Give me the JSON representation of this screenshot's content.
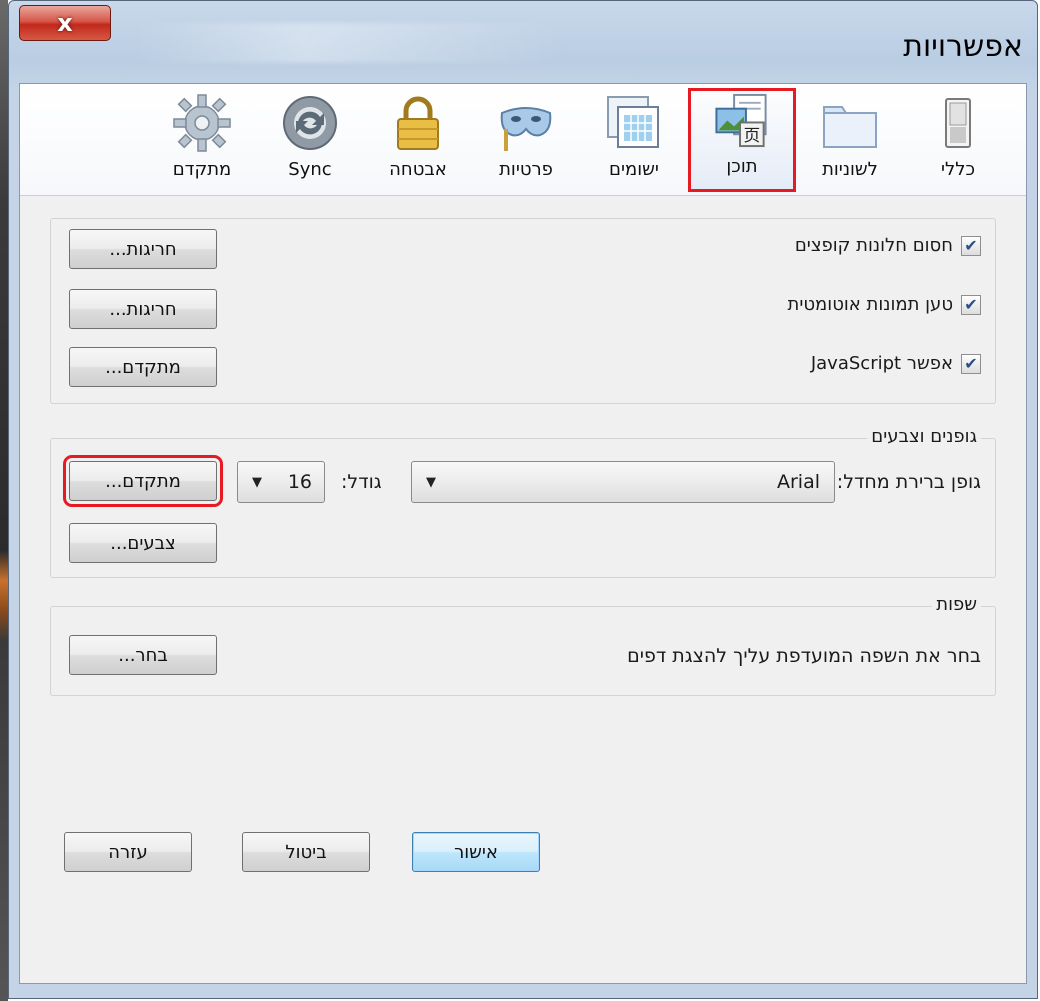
{
  "window": {
    "title": "אפשרויות",
    "close_label": "x"
  },
  "tabs": [
    {
      "label": "כללי",
      "icon": "general-switch-icon",
      "selected": false
    },
    {
      "label": "לשוניות",
      "icon": "tabs-folder-icon",
      "selected": false
    },
    {
      "label": "תוכן",
      "icon": "content-page-icon",
      "selected": true
    },
    {
      "label": "ישומים",
      "icon": "applications-window-icon",
      "selected": false
    },
    {
      "label": "פרטיות",
      "icon": "privacy-mask-icon",
      "selected": false
    },
    {
      "label": "אבטחה",
      "icon": "security-lock-icon",
      "selected": false
    },
    {
      "label": "Sync",
      "icon": "sync-arrows-icon",
      "selected": false
    },
    {
      "label": "מתקדם",
      "icon": "advanced-gear-icon",
      "selected": false
    }
  ],
  "content": {
    "popups": {
      "label": "חסום חלונות קופצים",
      "checked": true,
      "button": "חריגות..."
    },
    "images": {
      "label": "טען תמונות אוטומטית",
      "checked": true,
      "button": "חריגות..."
    },
    "javascript": {
      "label": "אפשר JavaScript",
      "checked": true,
      "button": "מתקדם..."
    }
  },
  "fonts": {
    "title": "גופנים וצבעים",
    "default_font_label": "גופן ברירת מחדל:",
    "default_font_value": "Arial",
    "size_label": "גודל:",
    "size_value": "16",
    "advanced_button": "מתקדם...",
    "colors_button": "צבעים..."
  },
  "languages": {
    "title": "שפות",
    "description": "בחר את השפה המועדפת עליך להצגת דפים",
    "choose_button": "בחר..."
  },
  "footer": {
    "ok": "אישור",
    "cancel": "ביטול",
    "help": "עזרה"
  }
}
